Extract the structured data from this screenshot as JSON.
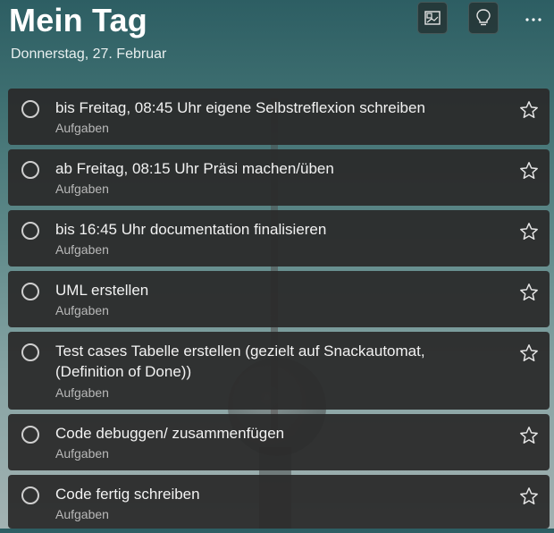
{
  "header": {
    "title": "Mein Tag",
    "date": "Donnerstag, 27. Februar",
    "buttons": [
      {
        "icon": "background-image-icon"
      },
      {
        "icon": "lightbulb-icon"
      },
      {
        "icon": "more-icon"
      }
    ]
  },
  "tasks": [
    {
      "title": "bis Freitag, 08:45 Uhr eigene Selbstreflexion schreiben",
      "list": "Aufgaben",
      "starred": false
    },
    {
      "title": "ab Freitag, 08:15 Uhr Präsi machen/üben",
      "list": "Aufgaben",
      "starred": false
    },
    {
      "title": "bis 16:45 Uhr documentation finalisieren",
      "list": "Aufgaben",
      "starred": false
    },
    {
      "title": "UML erstellen",
      "list": "Aufgaben",
      "starred": false
    },
    {
      "title": "Test cases Tabelle erstellen (gezielt auf Snackautomat, (Definition of Done))",
      "list": "Aufgaben",
      "starred": false
    },
    {
      "title": "Code debuggen/ zusammenfügen",
      "list": "Aufgaben",
      "starred": false
    },
    {
      "title": "Code fertig schreiben",
      "list": "Aufgaben",
      "starred": false
    }
  ],
  "colors": {
    "card": "#2b2b2b",
    "text": "#f2f2f2",
    "subtext": "#b9b9b9"
  }
}
